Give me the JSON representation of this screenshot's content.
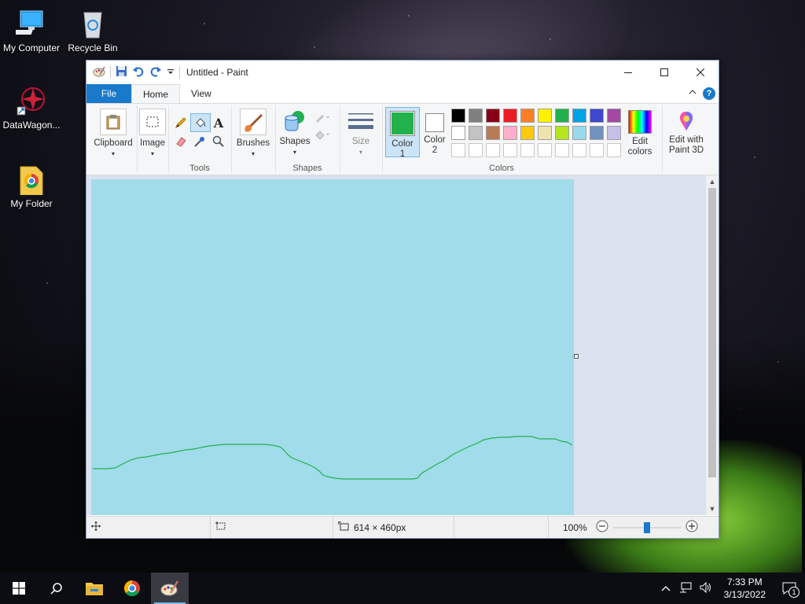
{
  "desktop": {
    "icons": [
      {
        "label": "My Computer"
      },
      {
        "label": "Recycle Bin"
      },
      {
        "label": "DataWagon..."
      },
      {
        "label": "My Folder"
      }
    ]
  },
  "window": {
    "title": "Untitled - Paint",
    "tabs": [
      {
        "label": "File"
      },
      {
        "label": "Home"
      },
      {
        "label": "View"
      }
    ],
    "help_glyph": "?"
  },
  "ribbon": {
    "clipboard": {
      "label": "Clipboard"
    },
    "image": {
      "label": "Image"
    },
    "tools": {
      "group_label": "Tools",
      "text_glyph": "A"
    },
    "brushes": {
      "label": "Brushes"
    },
    "shapes": {
      "label": "Shapes",
      "group_label": "Shapes"
    },
    "size": {
      "label": "Size"
    },
    "color1": {
      "label_line1": "Color",
      "label_line2": "1",
      "color": "#22b14c"
    },
    "color2": {
      "label_line1": "Color",
      "label_line2": "2",
      "color": "#ffffff"
    },
    "colors_group_label": "Colors",
    "edit_colors": {
      "label_line1": "Edit",
      "label_line2": "colors"
    },
    "paint3d": {
      "label_line1": "Edit with",
      "label_line2": "Paint 3D"
    },
    "palette_row1": [
      "#000000",
      "#7f7f7f",
      "#880015",
      "#ed1c24",
      "#ff7f27",
      "#fff200",
      "#22b14c",
      "#00a2e8",
      "#3f48cc",
      "#a349a4"
    ],
    "palette_row2": [
      "#ffffff",
      "#c3c3c3",
      "#b97a57",
      "#ffaec9",
      "#ffc90e",
      "#efe4b0",
      "#b5e61d",
      "#99d9ea",
      "#7092be",
      "#c8bfe7"
    ]
  },
  "canvas": {
    "background": "#a0dcea",
    "stroke_color": "#22b14c"
  },
  "statusbar": {
    "dimensions": "614 × 460px",
    "zoom": "100%",
    "zoom_level": 1.0
  },
  "taskbar": {
    "time": "7:33 PM",
    "date": "3/13/2022",
    "notification_count": "1"
  }
}
